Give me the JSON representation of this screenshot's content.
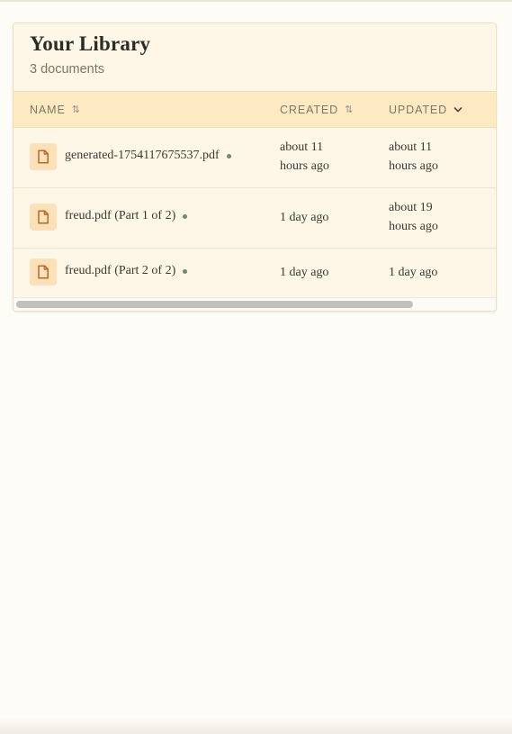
{
  "library": {
    "title": "Your Library",
    "subtitle": "3 documents"
  },
  "table": {
    "columns": [
      {
        "label": "NAME",
        "sort": "⇅"
      },
      {
        "label": "CREATED",
        "sort": "⇅"
      },
      {
        "label": "UPDATED",
        "sort": "chevron-down-icon"
      }
    ],
    "rows": [
      {
        "name": "generated-1754117675537.pdf",
        "created_line1": "about 11",
        "created_line2": "hours ago",
        "updated_line1": "about 11",
        "updated_line2": "hours ago"
      },
      {
        "name": "freud.pdf (Part 1 of 2)",
        "created_line1": "1 day ago",
        "created_line2": "",
        "updated_line1": "about 19",
        "updated_line2": "hours ago"
      },
      {
        "name": "freud.pdf (Part 2 of 2)",
        "created_line1": "1 day ago",
        "created_line2": "",
        "updated_line1": "1 day ago",
        "updated_line2": ""
      }
    ]
  },
  "icons": {
    "document": "document-icon",
    "status": "status-dot"
  },
  "colors": {
    "accent_icon": "#b8662a",
    "icon_bg": "#fbe0b8",
    "status_dot": "#6e8a68",
    "header_bg": "#fdeac2"
  }
}
